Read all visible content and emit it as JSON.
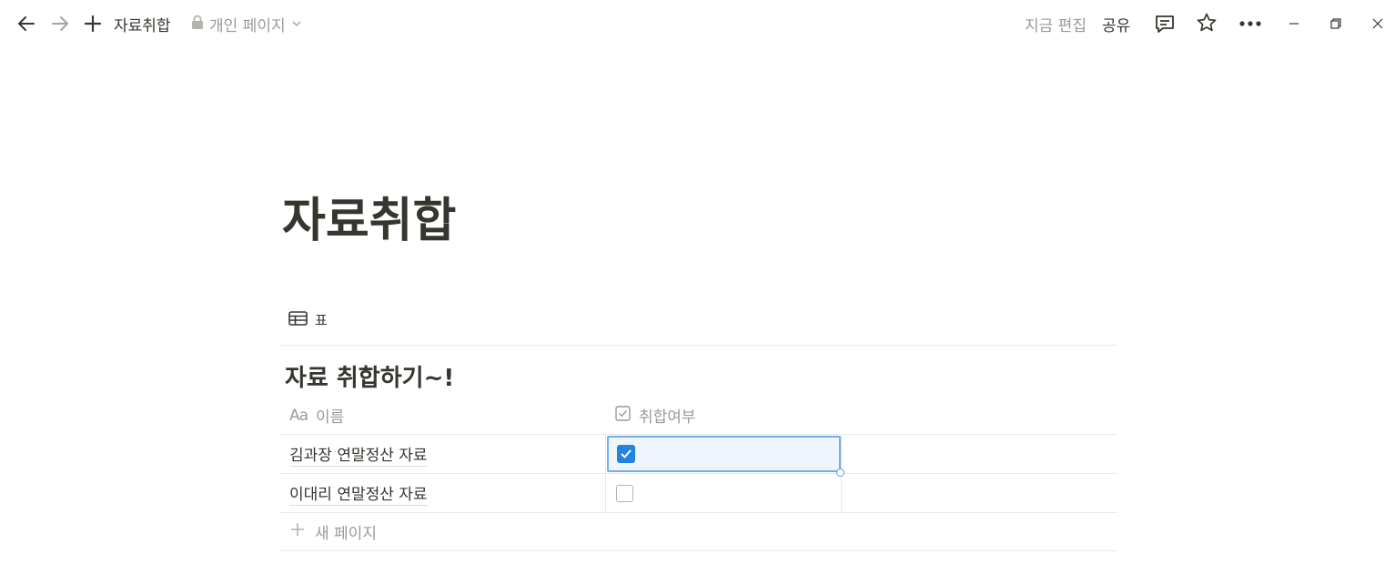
{
  "topbar": {
    "breadcrumb": "자료취합",
    "privacy_label": "개인 페이지",
    "edited_label": "지금 편집",
    "share_label": "공유"
  },
  "page": {
    "title": "자료취합"
  },
  "view": {
    "tab_label": "표"
  },
  "database": {
    "title": "자료 취합하기~!",
    "columns": [
      {
        "label": "이름",
        "type_glyph": "Aa"
      },
      {
        "label": "취합여부"
      }
    ],
    "rows": [
      {
        "name": "김과장 연말정산 자료",
        "checked": true
      },
      {
        "name": "이대리 연말정산 자료",
        "checked": false
      }
    ],
    "new_page_label": "새 페이지"
  },
  "colors": {
    "accent": "#2383e2",
    "text": "#37352f",
    "muted": "#9b9a97"
  }
}
